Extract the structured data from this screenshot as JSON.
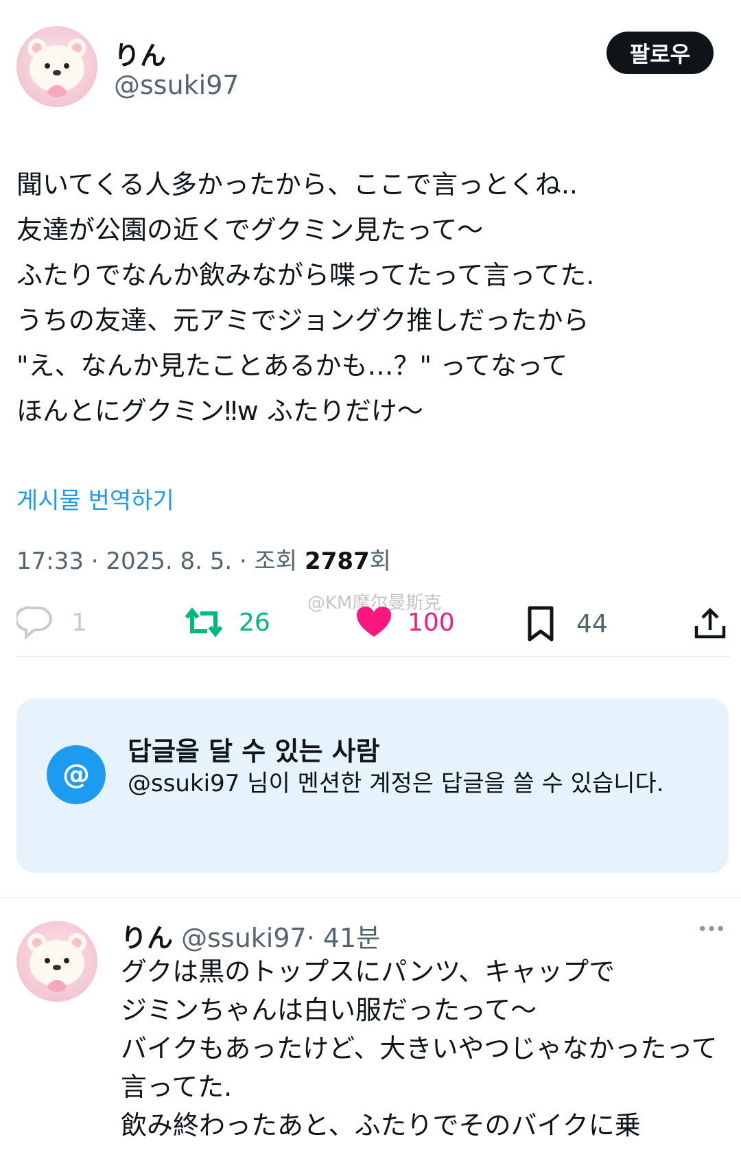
{
  "tweet": {
    "author_name": "りん",
    "author_handle": "@ssuki97",
    "follow_label": "팔로우",
    "body": "聞いてくる人多かったから、ここで言っとくね..\n友達が公園の近くでグクミン見たって～\nふたりでなんか飲みながら喋ってたって言ってた.\nうちの友達、元アミでジョングク推しだったから\n\"え、なんか見たことあるかも…？\" ってなって\nほんとにグクミン‼w ふたりだけ～",
    "translate_label": "게시물 번역하기",
    "meta_prefix": "17:33 · 2025. 8. 5. · 조회 ",
    "views": "2787",
    "views_suffix": "회",
    "actions": {
      "replies": "1",
      "retweets": "26",
      "likes": "100",
      "bookmarks": "44"
    },
    "colors": {
      "retweet": "#00ba7c",
      "like": "#f91880"
    }
  },
  "watermark": "@KM摩尔曼斯克",
  "reply_restriction": {
    "icon": "@",
    "title": "답글을 달 수 있는 사람",
    "description": "@ssuki97 님이 멘션한 계정은 답글을 쓸 수 있습니다."
  },
  "reply": {
    "author_name": "りん",
    "author_handle": "@ssuki97",
    "time": "· 41분",
    "more": "•••",
    "body": "グクは黒のトップスにパンツ、キャップで\nジミンちゃんは白い服だったって～\nバイクもあったけど、大きいやつじゃなかったって\n言ってた.\n飲み終わったあと、ふたりでそのバイクに乗"
  }
}
